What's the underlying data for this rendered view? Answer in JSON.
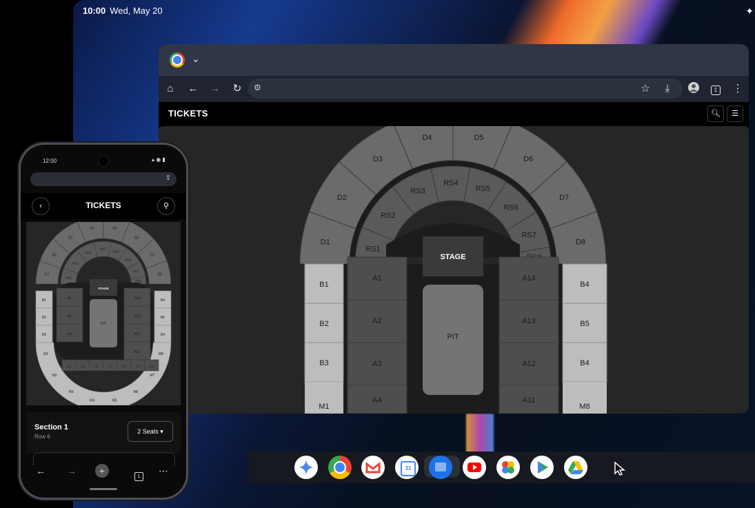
{
  "system": {
    "time": "10:00",
    "date": "Wed, May 20"
  },
  "browser": {
    "page_title": "TICKETS",
    "toolbar_icons": [
      "home-icon",
      "back-icon",
      "forward-icon",
      "reload-icon",
      "tune-icon",
      "star-icon",
      "download-icon",
      "profile-icon",
      "tab-count-icon",
      "more-icon"
    ],
    "tab_count": "1"
  },
  "seat_map": {
    "stage_label": "STAGE",
    "pit_label": "PIT",
    "upper_sections": [
      "D1",
      "D2",
      "D3",
      "D4",
      "D5",
      "D6",
      "D7",
      "D8"
    ],
    "inner_sections": [
      "RS1",
      "RS2",
      "RS3",
      "RS4",
      "RS5",
      "RS6",
      "RS7",
      "RS8"
    ],
    "left_sections": [
      "B1",
      "B2",
      "B3"
    ],
    "right_sections": [
      "B4",
      "B5",
      "B4"
    ],
    "left_floor": [
      "A1",
      "A2",
      "A3",
      "A4"
    ],
    "right_floor": [
      "A14",
      "A13",
      "A12",
      "A11"
    ],
    "lower_left": "M1",
    "lower_right": "M8",
    "colors": {
      "outer": "#6b6b6b",
      "inner": "#5a5a5a",
      "light": "#bdbdbd",
      "floor": "#4e4e4e",
      "ring": "#1c1c1c",
      "stage": "#3a3a3a",
      "pit": "#747474"
    }
  },
  "phone": {
    "time": "12:00",
    "title": "TICKETS",
    "section_label": "Section 1",
    "row_label": "Row 6",
    "seats_label": "2 Seats",
    "tab_count": "1",
    "mini_map": {
      "upper": [
        "D1",
        "D2",
        "D3",
        "D4",
        "D5",
        "D6",
        "D7",
        "D8"
      ],
      "inner": [
        "RS1",
        "RS2",
        "RS3",
        "RS4",
        "RS5",
        "RS6",
        "RS7",
        "RS8"
      ],
      "left": [
        "B1",
        "B2",
        "B3"
      ],
      "right": [
        "B4",
        "B5",
        "B4"
      ],
      "floor_left": [
        "A1",
        "A2",
        "A3",
        "A4",
        "A5",
        "A6"
      ],
      "floor_right": [
        "A14",
        "A13",
        "A12",
        "A11",
        "A10",
        "A9",
        "A8",
        "A7"
      ],
      "bottom": [
        "M1",
        "M2",
        "M3",
        "M4",
        "M5",
        "M6",
        "M7",
        "M8"
      ],
      "stage": "STAGE",
      "pit": "PIT"
    }
  },
  "shelf": {
    "apps": [
      "google-search",
      "gemini",
      "chrome",
      "gmail",
      "calendar",
      "files",
      "youtube",
      "photos",
      "play-store",
      "drive"
    ],
    "google_label": "G",
    "calendar_day": "31"
  }
}
